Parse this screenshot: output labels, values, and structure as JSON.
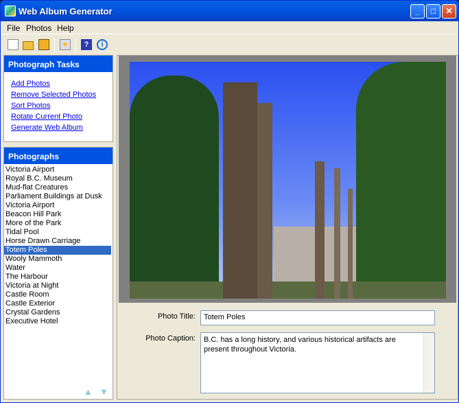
{
  "window": {
    "title": "Web Album Generator"
  },
  "menu": [
    "File",
    "Photos",
    "Help"
  ],
  "tasks": {
    "header": "Photograph Tasks",
    "items": [
      "Add Photos",
      "Remove Selected Photos",
      "Sort Photos",
      "Rotate Current Photo",
      "Generate Web Album"
    ]
  },
  "photographs": {
    "header": "Photographs",
    "items": [
      "Victoria Airport",
      "Royal B.C. Museum",
      "Mud-flat Creatures",
      "Parliament Buildings at Dusk",
      "Victoria Airport",
      "Beacon Hill Park",
      "More of the Park",
      "Tidal Pool",
      "Horse Drawn Carriage",
      "Totem Poles",
      "Wooly Mammoth",
      "Water",
      "The Harbour",
      "Victoria at Night",
      "Castle Room",
      "Castle Exterior",
      "Crystal Gardens",
      "Executive Hotel"
    ],
    "selected_index": 9
  },
  "details": {
    "title_label": "Photo Title:",
    "title_value": "Totem Poles",
    "caption_label": "Photo Caption:",
    "caption_value": "B.C. has a long history, and various historical artifacts are present throughout Victoria."
  },
  "icons": [
    "new-icon",
    "open-icon",
    "save-icon",
    "star-icon",
    "help-icon",
    "info-icon"
  ]
}
